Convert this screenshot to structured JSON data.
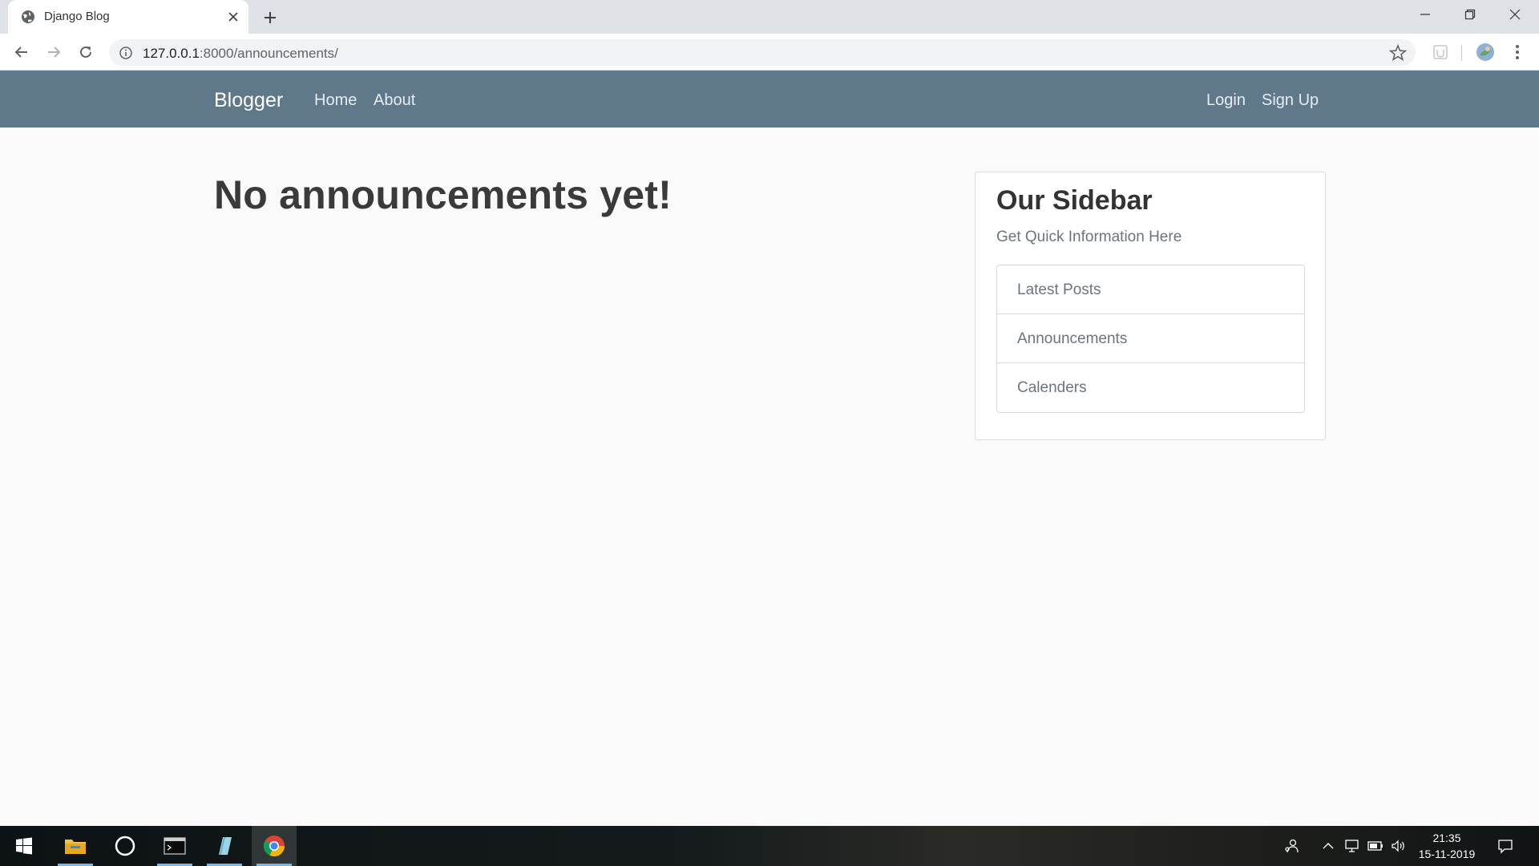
{
  "browser": {
    "tab_title": "Django Blog",
    "url_host": "127.0.0.1",
    "url_path": ":8000/announcements/"
  },
  "navbar": {
    "brand": "Blogger",
    "links_left": [
      "Home",
      "About"
    ],
    "links_right": [
      "Login",
      "Sign Up"
    ],
    "bg_color": "#5f788a"
  },
  "main": {
    "heading": "No announcements yet!"
  },
  "sidebar": {
    "title": "Our Sidebar",
    "subtitle": "Get Quick Information Here",
    "items": [
      "Latest Posts",
      "Announcements",
      "Calenders"
    ]
  },
  "taskbar": {
    "time": "21:35",
    "date": "15-11-2019",
    "apps": [
      "start-icon",
      "file-explorer-icon",
      "cortana-icon",
      "terminal-icon",
      "notepad-icon",
      "chrome-icon"
    ]
  }
}
